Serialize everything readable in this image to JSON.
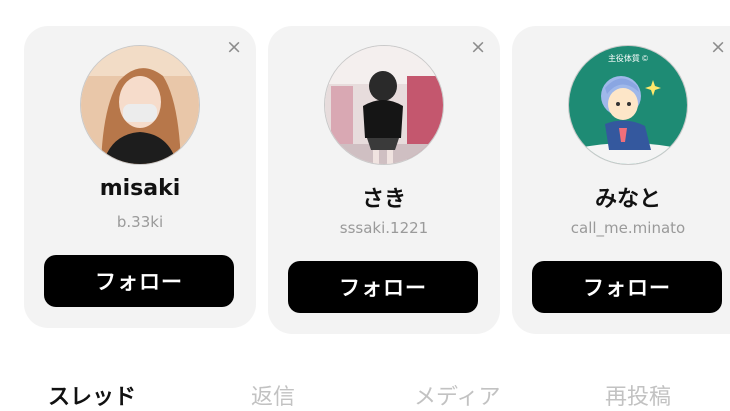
{
  "suggestions": [
    {
      "name": "misaki",
      "handle": "b.33ki",
      "follow_label": "フォロー",
      "close_glyph": "×",
      "avatar_icon": "avatar-photo-woman"
    },
    {
      "name": "さき",
      "handle": "sssaki.1221",
      "follow_label": "フォロー",
      "close_glyph": "×",
      "avatar_icon": "avatar-photo-mirror-selfie"
    },
    {
      "name": "みなと",
      "handle": "call_me.minato",
      "follow_label": "フォロー",
      "close_glyph": "×",
      "avatar_icon": "avatar-illustration",
      "avatar_text": "主役体質 ©"
    }
  ],
  "tabs": [
    {
      "label": "スレッド",
      "active": true
    },
    {
      "label": "返信",
      "active": false
    },
    {
      "label": "メディア",
      "active": false
    },
    {
      "label": "再投稿",
      "active": false
    }
  ],
  "colors": {
    "card_bg": "#f3f3f3",
    "button_bg": "#000000",
    "inactive_tab": "#c2c2c2",
    "avatar3_bg": "#1e8b74"
  }
}
